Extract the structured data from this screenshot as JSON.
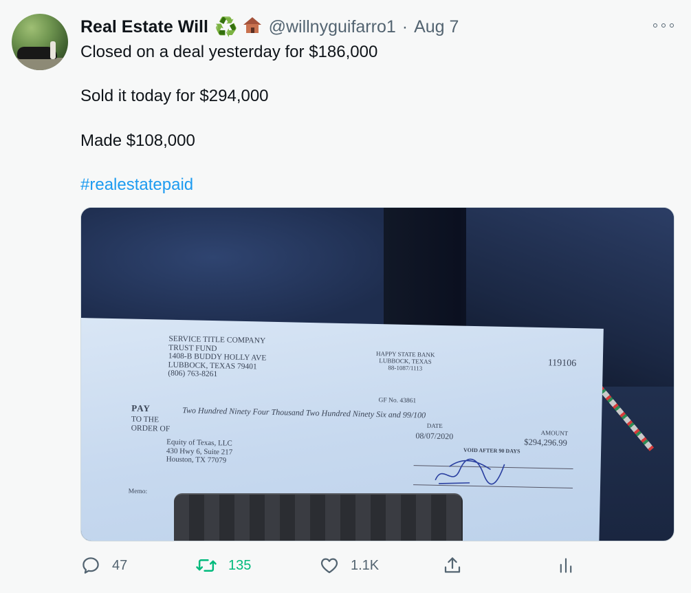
{
  "tweet": {
    "display_name": "Real Estate Will",
    "emoji1": "♻️",
    "handle": "@willnyguifarro1",
    "separator": "·",
    "time": "Aug 7",
    "lines": [
      "Closed on a deal yesterday for $186,000",
      "Sold it today for $294,000",
      "Made $108,000"
    ],
    "hashtag": "#realestatepaid",
    "colors": {
      "hashtag": "#1d9bf0",
      "retweet": "#00ba7c",
      "secondary": "#536471"
    }
  },
  "check": {
    "payer": [
      "SERVICE TITLE COMPANY",
      "TRUST FUND",
      "1408-B BUDDY HOLLY AVE",
      "LUBBOCK, TEXAS  79401",
      "(806) 763-8261"
    ],
    "bank": [
      "HAPPY STATE BANK",
      "LUBBOCK, TEXAS",
      "88-1087/1113"
    ],
    "check_number": "119106",
    "gf_no": "GF No.  43861",
    "pay_label": "PAY",
    "amount_words": "Two Hundred Ninety Four Thousand Two Hundred Ninety Six and 99/100",
    "to_order": [
      "TO THE",
      "ORDER OF"
    ],
    "date_label": "DATE",
    "date": "08/07/2020",
    "amount_label": "AMOUNT",
    "amount": "$294,296.99",
    "payee": [
      "Equity of Texas, LLC",
      "430 Hwy 6, Suite 217",
      "Houston, TX 77079"
    ],
    "void_text": "VOID AFTER 90 DAYS",
    "memo_label": "Memo:"
  },
  "actions": {
    "reply_count": "47",
    "retweet_count": "135",
    "like_count": "1.1K"
  },
  "icons": [
    "reply-icon",
    "retweet-icon",
    "like-icon",
    "share-icon",
    "analytics-icon",
    "more-icon"
  ]
}
